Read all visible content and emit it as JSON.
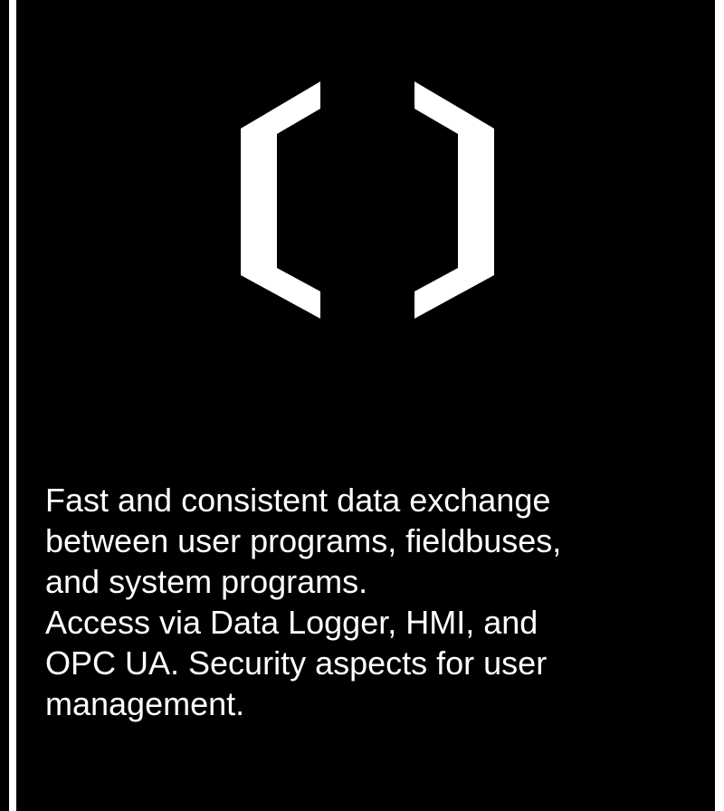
{
  "colors": {
    "background": "#000000",
    "foreground": "#ffffff",
    "frame": "#ffffff"
  },
  "logo": {
    "icon": "brackets-icon"
  },
  "description": {
    "lines": [
      "Fast and consistent data exchange",
      "between user programs, fieldbuses,",
      "and system programs.",
      "Access via Data Logger, HMI, and",
      "OPC UA. Security aspects for user",
      "management."
    ]
  }
}
